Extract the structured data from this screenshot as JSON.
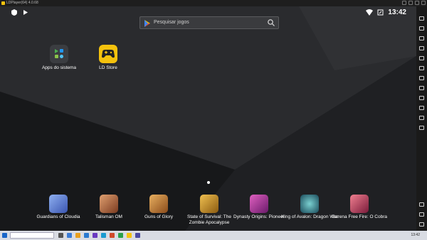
{
  "window": {
    "title": "LDPlayer(64) 4.0.68"
  },
  "status": {
    "time": "13:42"
  },
  "search": {
    "placeholder": "Pesquisar jogos"
  },
  "home_apps": [
    {
      "label": "Apps do sistema",
      "icon": "apps-folder-icon"
    },
    {
      "label": "LD Store",
      "icon": "gamepad-icon",
      "color": "#f4c20d"
    }
  ],
  "dock": [
    {
      "label": "Guardians of Cloudia",
      "color": "#5a7bd6"
    },
    {
      "label": "Talisman OM",
      "color": "#b8603a"
    },
    {
      "label": "Guns of Glory",
      "color": "#c07a2c"
    },
    {
      "label": "State of Survival: The Zombie Apocalypse",
      "color": "#c98a2a"
    },
    {
      "label": "Dynasty Origins: Pioneer",
      "color": "#a8388f"
    },
    {
      "label": "King of Avalon: Dragon War",
      "color": "#3a8a8f"
    },
    {
      "label": "Garena Free Fire: O Cobra",
      "color": "#c44a5a"
    }
  ],
  "taskbar": {
    "clock": "13:42"
  }
}
